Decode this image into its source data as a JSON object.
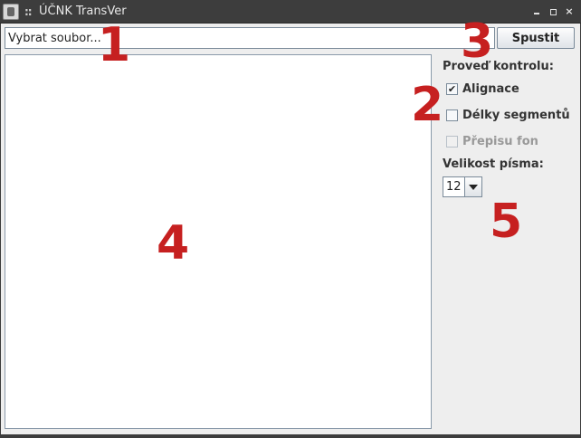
{
  "window": {
    "title": "ÚČNK TransVer",
    "grip": "::",
    "close_glyph": "×"
  },
  "file": {
    "placeholder": "Vybrat soubor...",
    "value": "Vybrat soubor..."
  },
  "toolbar": {
    "run_label": "Spustit"
  },
  "checks": {
    "heading": "Proveď kontrolu:",
    "items": [
      {
        "label": "Alignace",
        "checked": true,
        "enabled": true,
        "mark": "✔"
      },
      {
        "label": "Délky segmentů",
        "checked": false,
        "enabled": true,
        "mark": ""
      },
      {
        "label": "Přepisu fon",
        "checked": false,
        "enabled": false,
        "mark": ""
      }
    ]
  },
  "font_size": {
    "label": "Velikost písma:",
    "value": "12"
  },
  "markers": [
    "1",
    "2",
    "3",
    "4",
    "5"
  ],
  "colors": {
    "marker": "#c62020",
    "titlebar": "#3d3d3d",
    "panel": "#eeeeee"
  }
}
